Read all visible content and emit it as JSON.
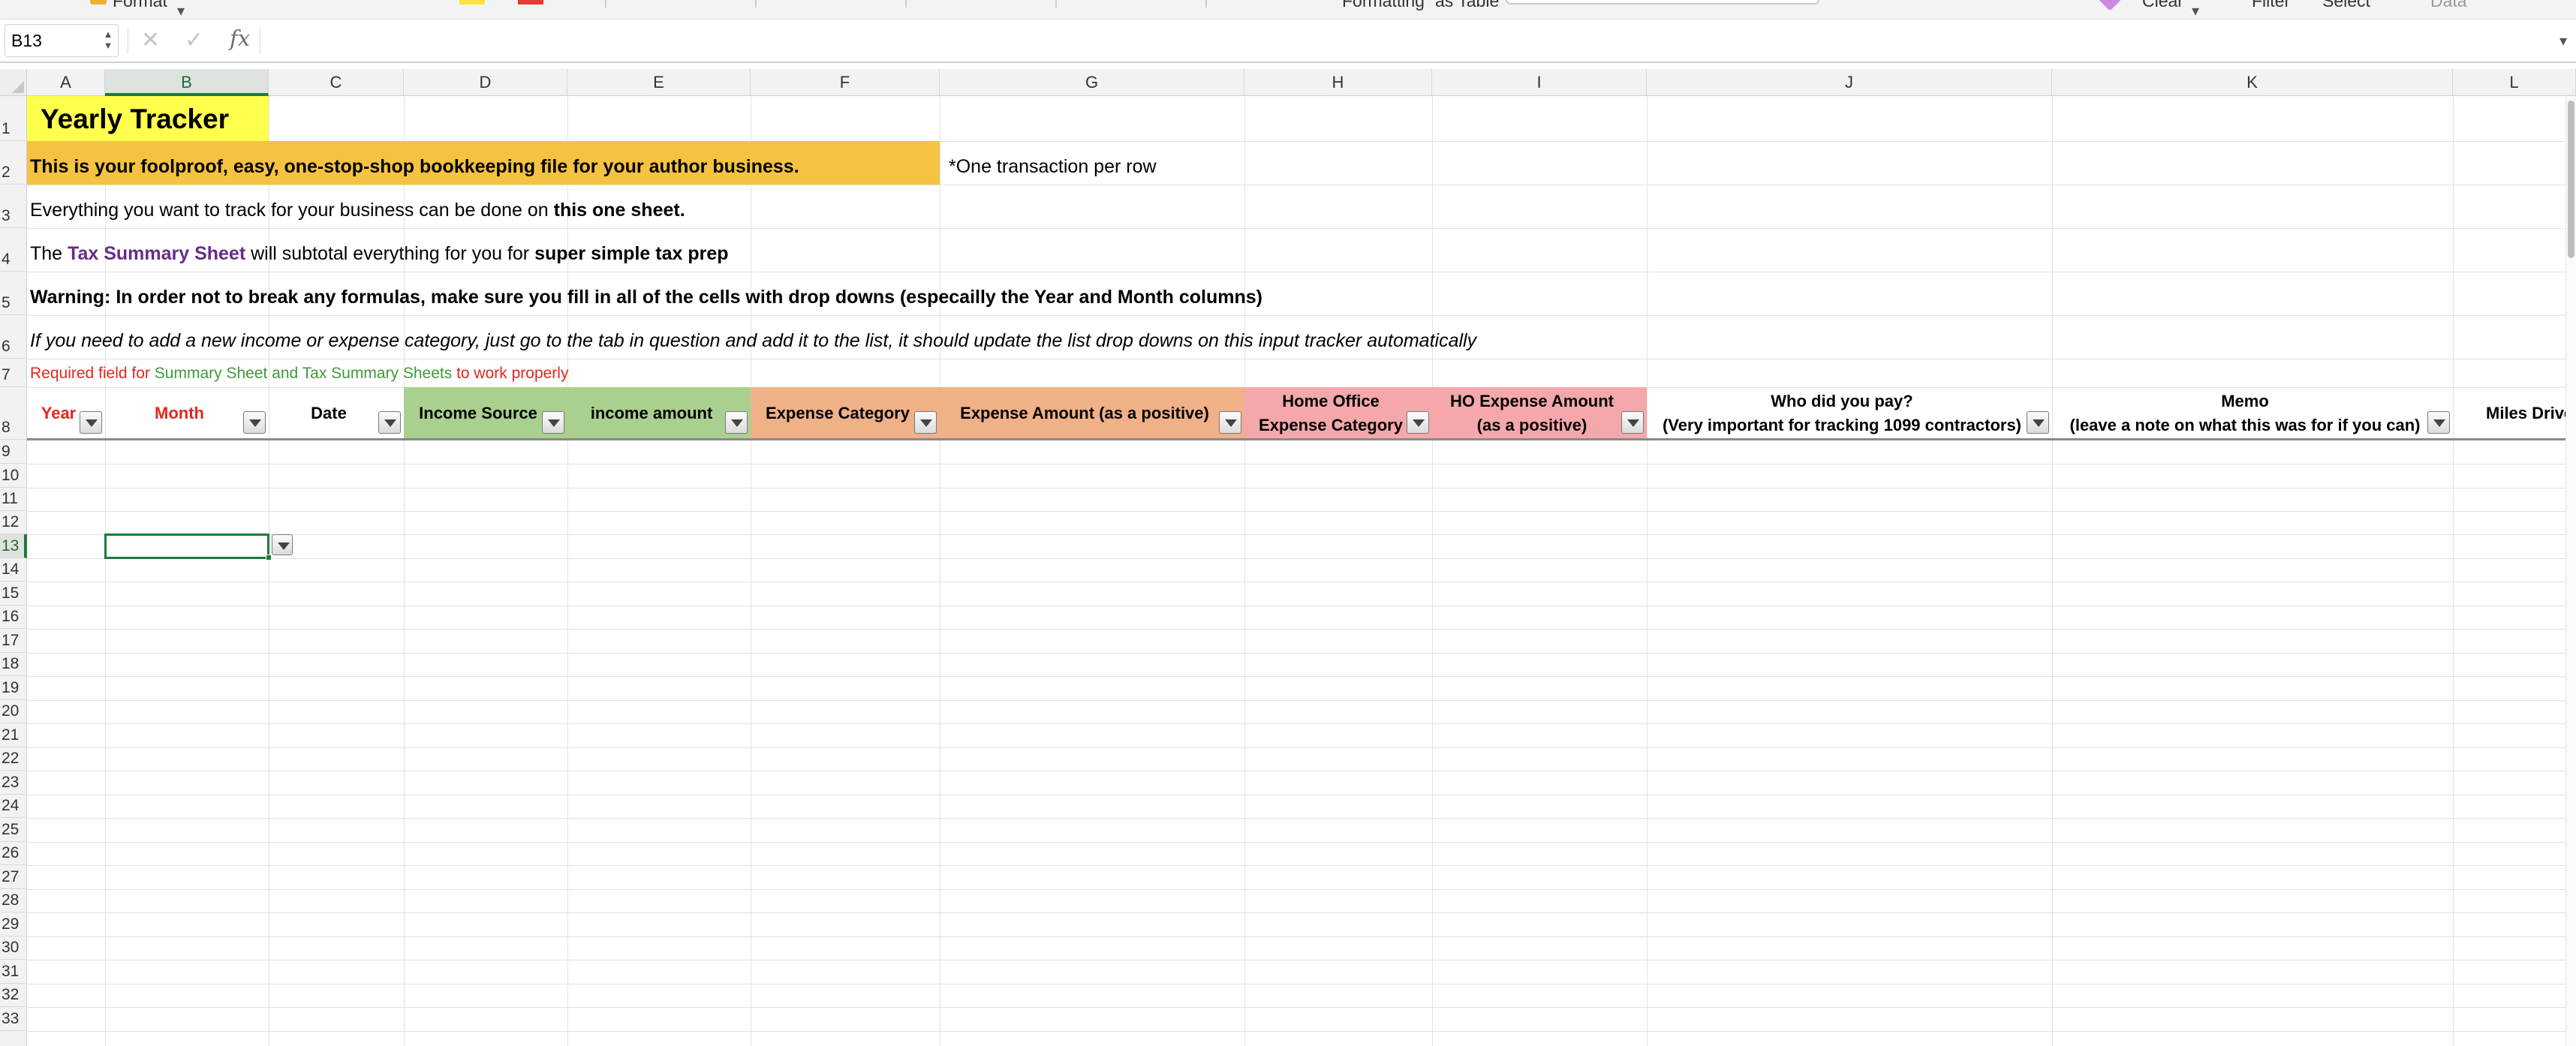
{
  "ribbon": {
    "format_label": "Format",
    "clear_label": "Clear",
    "filter_label": "Filter",
    "select_label": "Select",
    "formatting_label": "Formatting",
    "as_table_label": "as Table",
    "data_label": "Data"
  },
  "formula_bar": {
    "cell_reference": "B13",
    "cancel_icon": "✕",
    "enter_icon": "✓",
    "fx_label": "fx",
    "formula_value": ""
  },
  "columns": [
    "A",
    "B",
    "C",
    "D",
    "E",
    "F",
    "G",
    "H",
    "I",
    "J",
    "K",
    "L"
  ],
  "selected_column": "B",
  "rows": [
    "1",
    "2",
    "3",
    "4",
    "5",
    "6",
    "7",
    "8",
    "9",
    "10",
    "11",
    "12",
    "13",
    "14",
    "15",
    "16",
    "17",
    "18",
    "19",
    "20",
    "21",
    "22",
    "23",
    "24",
    "25",
    "26",
    "27",
    "28",
    "29",
    "30",
    "31",
    "32",
    "33"
  ],
  "selected_row": "13",
  "colors": {
    "title_yellow": "#ffff4d",
    "banner_orange": "#f5c242",
    "income_green": "#a9d08e",
    "expense_orange": "#f0b088",
    "home_office_pink": "#f4a8ab",
    "selection_green": "#1d7a3a",
    "required_red": "#e5261c",
    "required_green": "#3f9a3a",
    "link_purple": "#6a2b87"
  },
  "sheet": {
    "title": "Yearly Tracker",
    "banner": "This is your foolproof, easy, one-stop-shop bookkeeping file for your author business.",
    "one_transaction_note": "*One transaction per row",
    "row3_prefix": "Everything you want to track for your business can be done on ",
    "row3_bold": "this one sheet.",
    "row4_the": "The ",
    "row4_link": "Tax Summary Sheet",
    "row4_middle": " will subtotal everything for you for ",
    "row4_bold": "super simple tax prep",
    "warning": "Warning: In order not to break any formulas, make sure you fill in all of the cells with drop downs (especailly the Year and Month columns)",
    "row6_note": "If you need to add a new income or expense category, just go to the tab in question and add it to the list, it should update the list drop downs on this input tracker automatically",
    "required_prefix": "Required field for ",
    "required_middle": "Summary Sheet and Tax Summary Sheets",
    "required_suffix": " to work properly"
  },
  "headers": {
    "year": "Year",
    "month": "Month",
    "date": "Date",
    "income_source": "Income Source",
    "income_amount": "income amount",
    "expense_category": "Expense Category",
    "expense_amount": "Expense Amount (as a positive)",
    "home_office_line1": "Home Office",
    "home_office_line2": "Expense Category",
    "ho_amount_line1": "HO Expense Amount",
    "ho_amount_line2": "(as a positive)",
    "who_paid_line1": "Who did you pay?",
    "who_paid_line2": "(Very important for tracking 1099 contractors)",
    "memo_line1": "Memo",
    "memo_line2": "(leave a note on what this was for if you can)",
    "miles": "Miles Drive"
  }
}
